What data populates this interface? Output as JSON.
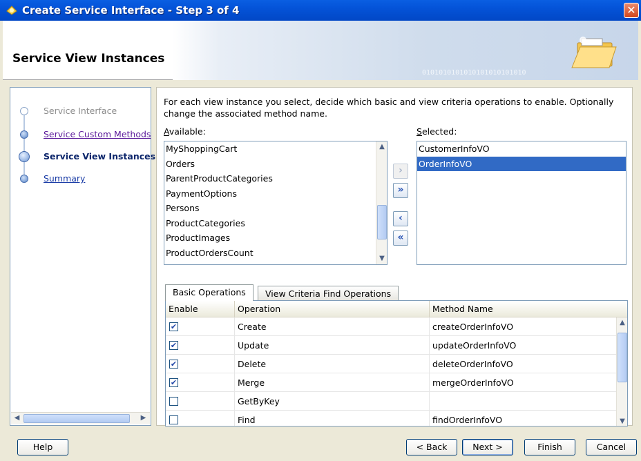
{
  "window": {
    "title": "Create Service Interface - Step 3 of 4",
    "close_glyph": "✕"
  },
  "banner": {
    "heading": "Service View Instances",
    "binary_text": "0101010101010101010101010"
  },
  "steps": [
    {
      "label": "Service Interface",
      "state": "done-gray"
    },
    {
      "label": "Service Custom Methods",
      "state": "visited"
    },
    {
      "label": "Service View Instances",
      "state": "current"
    },
    {
      "label": "Summary",
      "state": "link"
    }
  ],
  "main": {
    "description": "For each view instance you select, decide which basic and view criteria operations to enable. Optionally change the associated method name.",
    "available_label": "Available:",
    "available_items": [
      "MyShoppingCart",
      "Orders",
      "ParentProductCategories",
      "PaymentOptions",
      "Persons",
      "ProductCategories",
      "ProductImages",
      "ProductOrdersCount"
    ],
    "selected_label": "Selected:",
    "selected_items": [
      "CustomerInfoVO",
      "OrderInfoVO"
    ],
    "selected_index": 1,
    "shuttle": {
      "add": "›",
      "add_all": "»",
      "remove": "‹",
      "remove_all": "«"
    },
    "tabs": [
      "Basic Operations",
      "View Criteria Find Operations"
    ],
    "table": {
      "headers": [
        "Enable",
        "Operation",
        "Method Name"
      ],
      "rows": [
        {
          "checked": true,
          "operation": "Create",
          "method": "createOrderInfoVO"
        },
        {
          "checked": true,
          "operation": "Update",
          "method": "updateOrderInfoVO"
        },
        {
          "checked": true,
          "operation": "Delete",
          "method": "deleteOrderInfoVO"
        },
        {
          "checked": true,
          "operation": "Merge",
          "method": "mergeOrderInfoVO"
        },
        {
          "checked": false,
          "operation": "GetByKey",
          "method": ""
        },
        {
          "checked": false,
          "operation": "Find",
          "method": "findOrderInfoVO"
        }
      ]
    }
  },
  "buttons": {
    "help": "Help",
    "back": "< Back",
    "next": "Next >",
    "finish": "Finish",
    "cancel": "Cancel"
  }
}
